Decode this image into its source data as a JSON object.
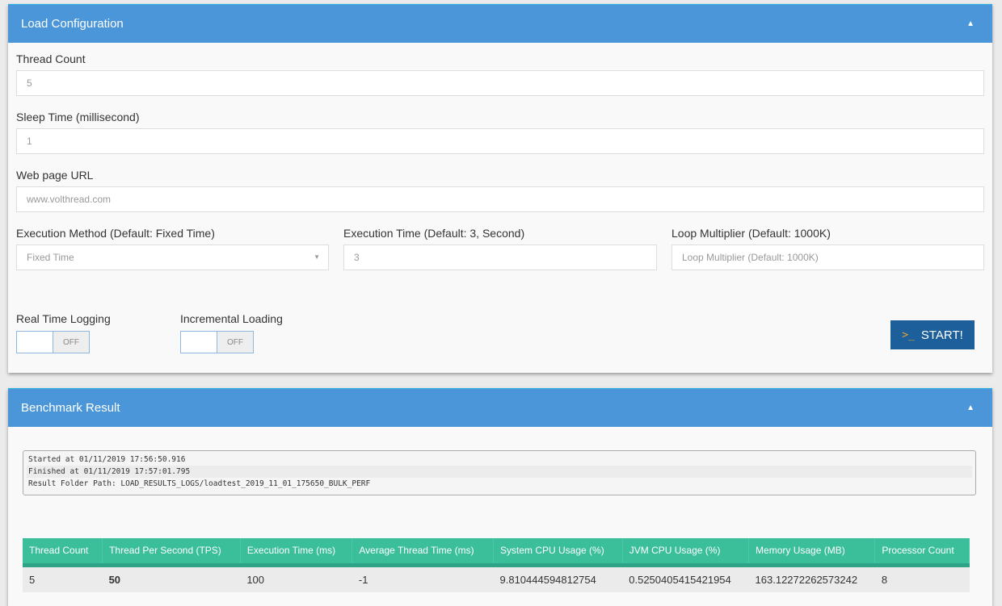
{
  "load_config": {
    "title": "Load Configuration",
    "collapse_icon": "chevron-up-icon",
    "thread_count": {
      "label": "Thread Count",
      "value": "5"
    },
    "sleep_time": {
      "label": "Sleep Time (millisecond)",
      "value": "1"
    },
    "web_url": {
      "label": "Web page URL",
      "placeholder": "www.volthread.com"
    },
    "execution_method": {
      "label": "Execution Method (Default: Fixed Time)",
      "selected": "Fixed Time"
    },
    "execution_time": {
      "label": "Execution Time (Default: 3, Second)",
      "value": "3"
    },
    "loop_multiplier": {
      "label": "Loop Multiplier (Default: 1000K)",
      "placeholder": "Loop Multiplier (Default: 1000K)"
    },
    "real_time_logging": {
      "label": "Real Time Logging",
      "state": "OFF"
    },
    "incremental_loading": {
      "label": "Incremental Loading",
      "state": "OFF"
    },
    "start_button": {
      "icon": ">_",
      "label": "START!"
    }
  },
  "benchmark": {
    "title": "Benchmark Result",
    "log": [
      "Started at 01/11/2019 17:56:50.916",
      "Finished at 01/11/2019 17:57:01.795",
      "Result Folder Path: LOAD_RESULTS_LOGS/loadtest_2019_11_01_175650_BULK_PERF"
    ],
    "columns": [
      "Thread Count",
      "Thread Per Second (TPS)",
      "Execution Time (ms)",
      "Average Thread Time (ms)",
      "System CPU Usage (%)",
      "JVM CPU Usage (%)",
      "Memory Usage (MB)",
      "Processor Count"
    ],
    "rows": [
      [
        "5",
        "50",
        "100",
        "-1",
        "9.810444594812754",
        "0.5250405415421954",
        "163.12272262573242",
        "8"
      ]
    ]
  },
  "colors": {
    "header_blue": "#4a96d8",
    "start_button": "#1d5f9b",
    "table_header": "#3bbf9b"
  }
}
